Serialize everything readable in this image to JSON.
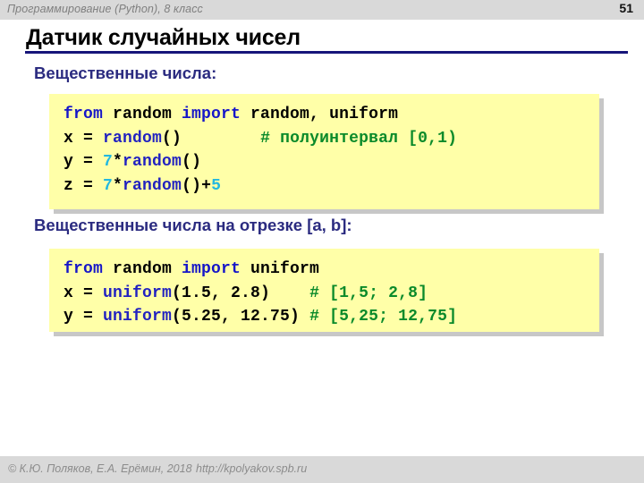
{
  "header": {
    "course": "Программирование (Python), 8 класс",
    "page_number": "51"
  },
  "title": "Датчик случайных чисел",
  "sections": [
    {
      "subtitle": "Вещественные числа:"
    },
    {
      "subtitle": "Вещественные числа на отрезке [a, b]:"
    }
  ],
  "code_blocks": [
    {
      "lines": [
        {
          "kw1": "from",
          "sp1": " random ",
          "kw2": "import",
          "rest": " random, uniform"
        },
        {
          "var": "x = ",
          "fn": "random",
          "paren": "()",
          "pad": "        ",
          "comment": "# полуинтервал [0,1)"
        },
        {
          "var": "y = ",
          "num": "7",
          "op": "*",
          "fn": "random",
          "paren": "()"
        },
        {
          "var": "z = ",
          "num": "7",
          "op": "*",
          "fn": "random",
          "paren": "()+",
          "num2": "5"
        }
      ]
    },
    {
      "lines": [
        {
          "kw1": "from",
          "sp1": " random ",
          "kw2": "import",
          "rest": " uniform"
        },
        {
          "var": "x = ",
          "fn": "uniform",
          "args": "(1.5, 2.8)",
          "pad": "    ",
          "comment": "# [1,5; 2,8]"
        },
        {
          "var": "y = ",
          "fn": "uniform",
          "args": "(5.25, 12.75)",
          "pad": " ",
          "comment": "# [5,25; 12,75]"
        }
      ]
    }
  ],
  "footer": {
    "copyright": "© К.Ю. Поляков, Е.А. Ерёмин, 2018",
    "url": "http://kpolyakov.spb.ru"
  },
  "colors": {
    "header_bar": "#d9d9d9",
    "title_rule": "#17157a",
    "subtitle": "#2b2b80",
    "code_bg": "#ffffa8",
    "keyword": "#1616c8",
    "function": "#2222c0",
    "number": "#22b8e0",
    "comment": "#0a8a2a"
  }
}
